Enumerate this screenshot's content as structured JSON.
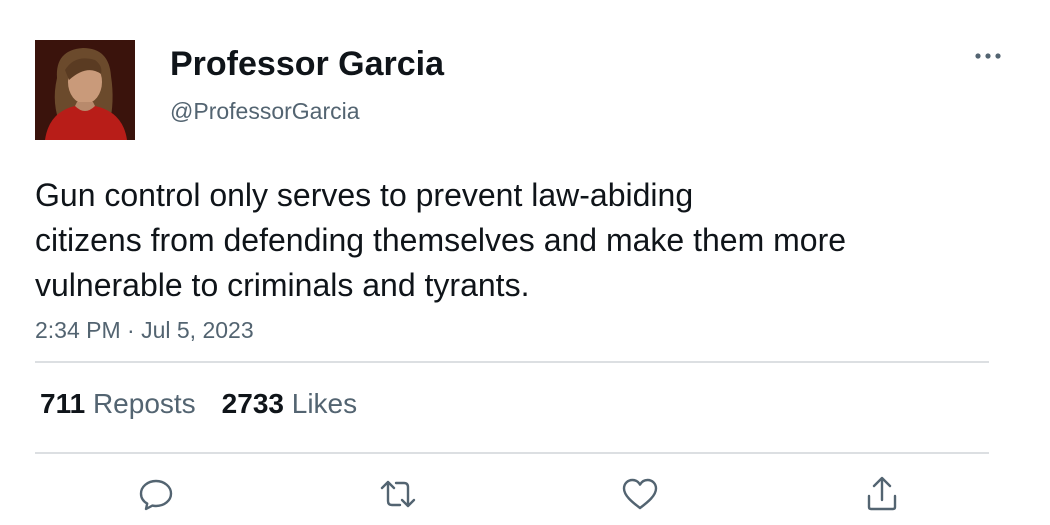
{
  "author": {
    "display_name": "Professor Garcia",
    "handle": "@ProfessorGarcia",
    "avatar_icon": "profile-photo"
  },
  "tweet": {
    "text_lines": [
      "Gun control only serves to prevent law-abiding",
      "citizens from defending themselves and make them more",
      "vulnerable to criminals and tyrants."
    ],
    "timestamp": "2:34 PM · Jul 5, 2023"
  },
  "stats": {
    "reposts_count": "711",
    "reposts_label": "Reposts",
    "likes_count": "2733",
    "likes_label": "Likes"
  },
  "actions": {
    "icons": [
      "reply-icon",
      "repost-icon",
      "like-icon",
      "share-icon"
    ],
    "icon_color": "#536471"
  },
  "colors": {
    "text_primary": "#0f1419",
    "text_secondary": "#536471",
    "divider": "#dcdfe2"
  }
}
